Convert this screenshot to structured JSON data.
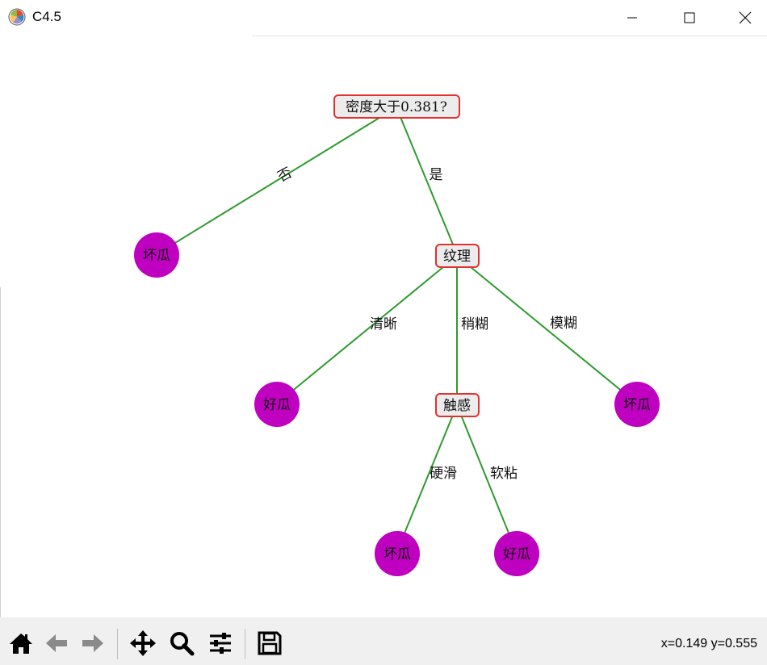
{
  "window": {
    "title": "C4.5"
  },
  "tree": {
    "root": {
      "label": "密度大于0.381?"
    },
    "n_texture": {
      "label": "纹理"
    },
    "n_touch": {
      "label": "触感"
    },
    "leaves": {
      "l_root_no": "坏瓜",
      "l_clear": "好瓜",
      "l_blurry": "坏瓜",
      "l_hard": "坏瓜",
      "l_soft": "好瓜"
    },
    "edges": {
      "e_no": "否",
      "e_yes": "是",
      "e_clear": "清晰",
      "e_slight": "稍糊",
      "e_blurry": "模糊",
      "e_hard": "硬滑",
      "e_soft": "软粘"
    },
    "colors": {
      "edge": "#2e9b2e",
      "decision_border": "#e53030",
      "decision_fill": "#ececec",
      "leaf_fill": "#c000c0"
    }
  },
  "toolbar": {
    "buttons": [
      "home-icon",
      "back-icon",
      "forward-icon",
      "pan-icon",
      "zoom-icon",
      "configure-icon",
      "save-icon"
    ],
    "coordinates": "x=0.149 y=0.555"
  }
}
